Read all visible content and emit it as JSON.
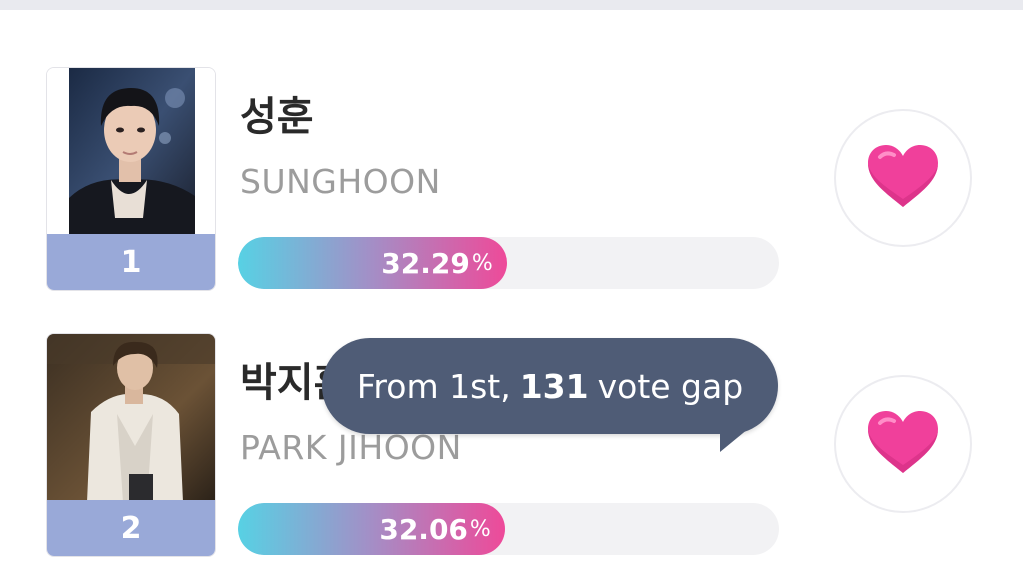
{
  "colors": {
    "rank_band": "#99a9d8",
    "bar_gradient_start": "#57d1e4",
    "bar_gradient_end": "#ee4a99",
    "heart": "#f0409b",
    "tooltip_bg": "#4f5c76"
  },
  "candidates": [
    {
      "rank": "1",
      "name_ko": "성훈",
      "name_en": "SUNGHOON",
      "percent": "32.29",
      "percent_sign": "%",
      "percent_value": 32.29,
      "vote_icon": "heart-icon"
    },
    {
      "rank": "2",
      "name_ko": "박지훈",
      "name_en": "PARK JIHOON",
      "percent": "32.06",
      "percent_sign": "%",
      "percent_value": 32.06,
      "vote_icon": "heart-icon"
    }
  ],
  "tooltip": {
    "prefix": "From 1st,",
    "gap": "131",
    "suffix": "vote gap"
  }
}
